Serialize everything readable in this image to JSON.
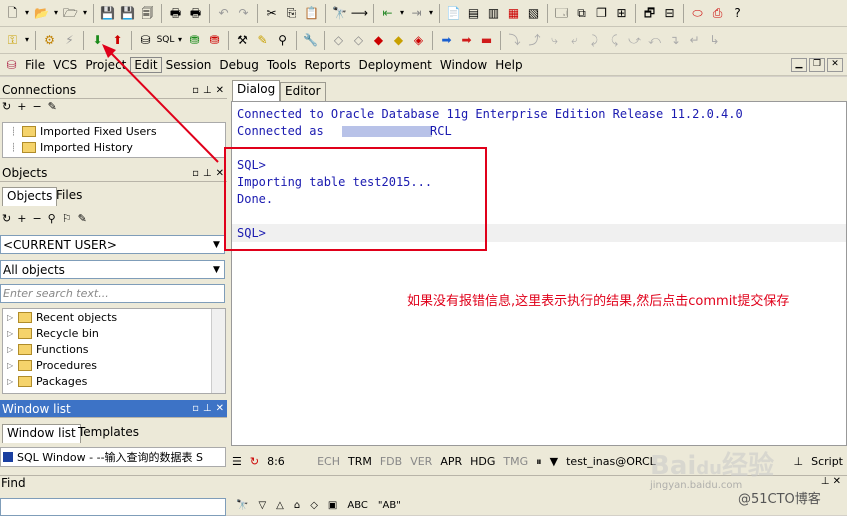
{
  "menubar": {
    "items": [
      "File",
      "VCS",
      "Project",
      "Edit",
      "Session",
      "Debug",
      "Tools",
      "Reports",
      "Deployment",
      "Window",
      "Help"
    ]
  },
  "connections": {
    "title": "Connections",
    "items": [
      "Imported Fixed Users",
      "Imported History"
    ]
  },
  "objects": {
    "title": "Objects",
    "tabs": [
      "Objects",
      "Files"
    ],
    "user_combo": "<CURRENT USER>",
    "filter_combo": "All objects",
    "search_placeholder": "Enter search text...",
    "tree": [
      "Recent objects",
      "Recycle bin",
      "Functions",
      "Procedures",
      "Packages"
    ]
  },
  "window_list": {
    "title": "Window list",
    "tabs": [
      "Window list",
      "Templates"
    ],
    "item": "SQL Window - --输入查询的数据表 S"
  },
  "find": {
    "label": "Find",
    "button_abc": "ABC",
    "button_ab": "\"AB\""
  },
  "editor": {
    "tabs": [
      "Dialog",
      "Editor"
    ],
    "lines": [
      "Connected to Oracle Database 11g Enterprise Edition Release 11.2.0.4.0",
      "Connected as",
      "RCL",
      "SQL>",
      "Importing table test2015...",
      "Done.",
      "SQL>"
    ],
    "annotation": "如果没有报错信息,这里表示执行的结果,然后点击commit提交保存"
  },
  "status": {
    "position": "8:6",
    "flags": [
      "ECH",
      "TRM",
      "FDB",
      "VER",
      "APR",
      "HDG",
      "TMG"
    ],
    "connection": "test_inas@ORCL",
    "script": "Script"
  },
  "watermark": {
    "site": "jingyan.baidu.com",
    "brand": "@51CTO博客"
  },
  "colors": {
    "console": "#1a1ab0",
    "annotation": "#e0001a",
    "highlight_box": "#e0001a",
    "arrow": "#e0001a"
  }
}
